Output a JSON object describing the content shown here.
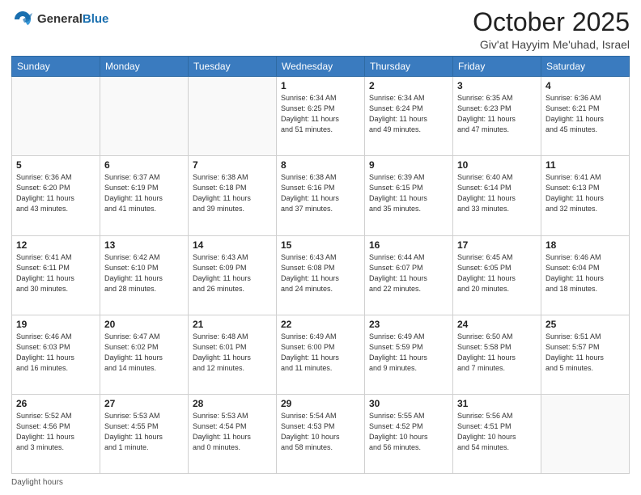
{
  "header": {
    "logo_general": "General",
    "logo_blue": "Blue",
    "month": "October 2025",
    "location": "Giv'at Hayyim Me'uhad, Israel"
  },
  "days_of_week": [
    "Sunday",
    "Monday",
    "Tuesday",
    "Wednesday",
    "Thursday",
    "Friday",
    "Saturday"
  ],
  "weeks": [
    [
      {
        "day": "",
        "info": ""
      },
      {
        "day": "",
        "info": ""
      },
      {
        "day": "",
        "info": ""
      },
      {
        "day": "1",
        "info": "Sunrise: 6:34 AM\nSunset: 6:25 PM\nDaylight: 11 hours\nand 51 minutes."
      },
      {
        "day": "2",
        "info": "Sunrise: 6:34 AM\nSunset: 6:24 PM\nDaylight: 11 hours\nand 49 minutes."
      },
      {
        "day": "3",
        "info": "Sunrise: 6:35 AM\nSunset: 6:23 PM\nDaylight: 11 hours\nand 47 minutes."
      },
      {
        "day": "4",
        "info": "Sunrise: 6:36 AM\nSunset: 6:21 PM\nDaylight: 11 hours\nand 45 minutes."
      }
    ],
    [
      {
        "day": "5",
        "info": "Sunrise: 6:36 AM\nSunset: 6:20 PM\nDaylight: 11 hours\nand 43 minutes."
      },
      {
        "day": "6",
        "info": "Sunrise: 6:37 AM\nSunset: 6:19 PM\nDaylight: 11 hours\nand 41 minutes."
      },
      {
        "day": "7",
        "info": "Sunrise: 6:38 AM\nSunset: 6:18 PM\nDaylight: 11 hours\nand 39 minutes."
      },
      {
        "day": "8",
        "info": "Sunrise: 6:38 AM\nSunset: 6:16 PM\nDaylight: 11 hours\nand 37 minutes."
      },
      {
        "day": "9",
        "info": "Sunrise: 6:39 AM\nSunset: 6:15 PM\nDaylight: 11 hours\nand 35 minutes."
      },
      {
        "day": "10",
        "info": "Sunrise: 6:40 AM\nSunset: 6:14 PM\nDaylight: 11 hours\nand 33 minutes."
      },
      {
        "day": "11",
        "info": "Sunrise: 6:41 AM\nSunset: 6:13 PM\nDaylight: 11 hours\nand 32 minutes."
      }
    ],
    [
      {
        "day": "12",
        "info": "Sunrise: 6:41 AM\nSunset: 6:11 PM\nDaylight: 11 hours\nand 30 minutes."
      },
      {
        "day": "13",
        "info": "Sunrise: 6:42 AM\nSunset: 6:10 PM\nDaylight: 11 hours\nand 28 minutes."
      },
      {
        "day": "14",
        "info": "Sunrise: 6:43 AM\nSunset: 6:09 PM\nDaylight: 11 hours\nand 26 minutes."
      },
      {
        "day": "15",
        "info": "Sunrise: 6:43 AM\nSunset: 6:08 PM\nDaylight: 11 hours\nand 24 minutes."
      },
      {
        "day": "16",
        "info": "Sunrise: 6:44 AM\nSunset: 6:07 PM\nDaylight: 11 hours\nand 22 minutes."
      },
      {
        "day": "17",
        "info": "Sunrise: 6:45 AM\nSunset: 6:05 PM\nDaylight: 11 hours\nand 20 minutes."
      },
      {
        "day": "18",
        "info": "Sunrise: 6:46 AM\nSunset: 6:04 PM\nDaylight: 11 hours\nand 18 minutes."
      }
    ],
    [
      {
        "day": "19",
        "info": "Sunrise: 6:46 AM\nSunset: 6:03 PM\nDaylight: 11 hours\nand 16 minutes."
      },
      {
        "day": "20",
        "info": "Sunrise: 6:47 AM\nSunset: 6:02 PM\nDaylight: 11 hours\nand 14 minutes."
      },
      {
        "day": "21",
        "info": "Sunrise: 6:48 AM\nSunset: 6:01 PM\nDaylight: 11 hours\nand 12 minutes."
      },
      {
        "day": "22",
        "info": "Sunrise: 6:49 AM\nSunset: 6:00 PM\nDaylight: 11 hours\nand 11 minutes."
      },
      {
        "day": "23",
        "info": "Sunrise: 6:49 AM\nSunset: 5:59 PM\nDaylight: 11 hours\nand 9 minutes."
      },
      {
        "day": "24",
        "info": "Sunrise: 6:50 AM\nSunset: 5:58 PM\nDaylight: 11 hours\nand 7 minutes."
      },
      {
        "day": "25",
        "info": "Sunrise: 6:51 AM\nSunset: 5:57 PM\nDaylight: 11 hours\nand 5 minutes."
      }
    ],
    [
      {
        "day": "26",
        "info": "Sunrise: 5:52 AM\nSunset: 4:56 PM\nDaylight: 11 hours\nand 3 minutes."
      },
      {
        "day": "27",
        "info": "Sunrise: 5:53 AM\nSunset: 4:55 PM\nDaylight: 11 hours\nand 1 minute."
      },
      {
        "day": "28",
        "info": "Sunrise: 5:53 AM\nSunset: 4:54 PM\nDaylight: 11 hours\nand 0 minutes."
      },
      {
        "day": "29",
        "info": "Sunrise: 5:54 AM\nSunset: 4:53 PM\nDaylight: 10 hours\nand 58 minutes."
      },
      {
        "day": "30",
        "info": "Sunrise: 5:55 AM\nSunset: 4:52 PM\nDaylight: 10 hours\nand 56 minutes."
      },
      {
        "day": "31",
        "info": "Sunrise: 5:56 AM\nSunset: 4:51 PM\nDaylight: 10 hours\nand 54 minutes."
      },
      {
        "day": "",
        "info": ""
      }
    ]
  ],
  "footer": {
    "label": "Daylight hours"
  }
}
